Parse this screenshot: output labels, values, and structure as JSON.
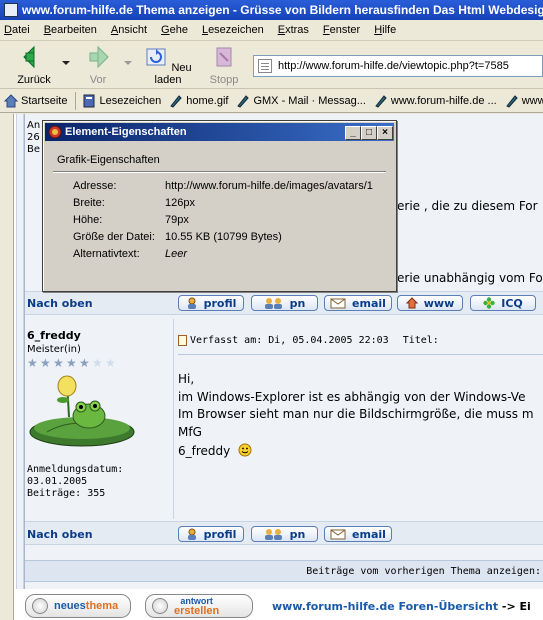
{
  "window": {
    "title": "www.forum-hilfe.de Thema anzeigen - Grüsse von Bildern herausfinden Das Html Webdesign W"
  },
  "menu": [
    "Datei",
    "Bearbeiten",
    "Ansicht",
    "Gehe",
    "Lesezeichen",
    "Extras",
    "Fenster",
    "Hilfe"
  ],
  "toolbar": {
    "back_label": "Zurück",
    "forward_label": "Vor",
    "reload_label": "Neu laden",
    "stop_label": "Stopp",
    "address": "http://www.forum-hilfe.de/viewtopic.php?t=7585"
  },
  "bookmarks": [
    "Startseite",
    "Lesezeichen",
    "home.gif",
    "GMX - Mail · Messag...",
    "www.forum-hilfe.de ...",
    "www.forum-hilfe.de"
  ],
  "post1_partial": {
    "left_line1": "An",
    "left_line2": "26",
    "left_line3": "Be",
    "text_a": "erie , die zu diesem For",
    "text_b": "erie unabhängig vom Fo"
  },
  "nach_oben": "Nach oben",
  "buttons": {
    "profil": "profil",
    "pn": "pn",
    "email": "email",
    "www": "www",
    "icq": "ICQ"
  },
  "post2": {
    "author": "6_freddy",
    "rank": "Meister(in)",
    "stars_filled": 5,
    "stars_total": 7,
    "joined_label": "Anmeldungsdatum:",
    "joined_date": "03.01.2005",
    "posts_label": "Beiträge: 355",
    "header": "Verfasst am: Di, 05.04.2005 22:03",
    "title_label": "Titel:",
    "lines": [
      "Hi,",
      "im Windows-Explorer ist es abhängig von der Windows-Ve",
      "Im Browser sieht man nur die Bildschirmgröße, die muss m",
      "MfG",
      "6_freddy"
    ]
  },
  "footer_nav": "Beiträge vom vorherigen Thema anzeigen:",
  "bottom": {
    "new_topic_a": "neues",
    "new_topic_b": "thema",
    "reply_a": "antwort",
    "reply_b": "erstellen",
    "forum_link": "www.forum-hilfe.de Foren-Übersicht",
    "forum_link_tail": "-> Ei"
  },
  "dialog": {
    "title": "Element-Eigenschaften",
    "section": "Grafik-Eigenschaften",
    "rows": [
      {
        "label": "Adresse:",
        "value": "http://www.forum-hilfe.de/images/avatars/1"
      },
      {
        "label": "Breite:",
        "value": "126px"
      },
      {
        "label": "Höhe:",
        "value": "79px"
      },
      {
        "label": "Größe der Datei:",
        "value": "10.55 KB (10799 Bytes)"
      },
      {
        "label": "Alternativtext:",
        "value": "Leer"
      }
    ]
  }
}
